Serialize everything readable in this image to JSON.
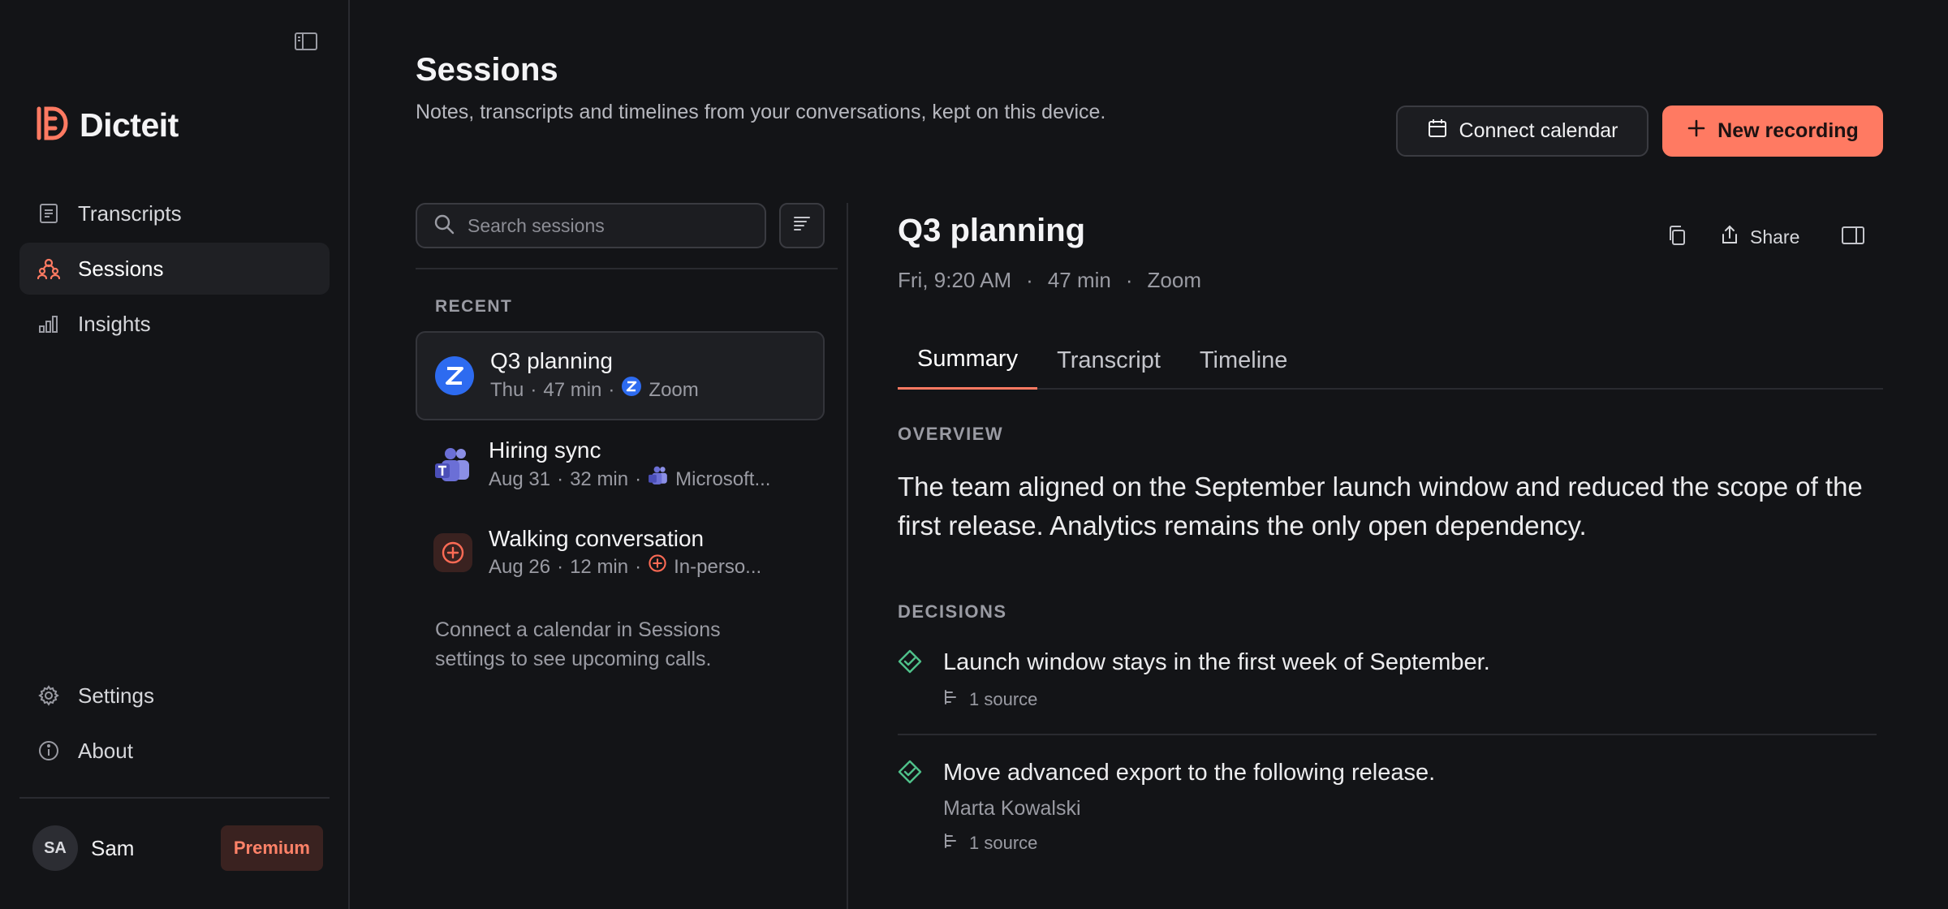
{
  "app": {
    "name": "Dicteit"
  },
  "sidebar": {
    "nav": [
      {
        "label": "Transcripts",
        "icon": "document-icon"
      },
      {
        "label": "Sessions",
        "icon": "people-icon",
        "active": true
      },
      {
        "label": "Insights",
        "icon": "bar-chart-icon"
      }
    ],
    "bottom": [
      {
        "label": "Settings",
        "icon": "gear-icon"
      },
      {
        "label": "About",
        "icon": "info-icon"
      }
    ],
    "user": {
      "initials": "SA",
      "name": "Sam",
      "plan": "Premium"
    }
  },
  "header": {
    "title": "Sessions",
    "subtitle": "Notes, transcripts and timelines from your conversations, kept on this device.",
    "connect_calendar": "Connect calendar",
    "new_recording": "New recording"
  },
  "list": {
    "search_placeholder": "Search sessions",
    "recent_label": "RECENT",
    "sessions": [
      {
        "title": "Q3 planning",
        "day": "Thu",
        "duration": "47 min",
        "source": "Zoom",
        "app": "zoom"
      },
      {
        "title": "Hiring sync",
        "day": "Aug 31",
        "duration": "32 min",
        "source": "Microsoft...",
        "app": "teams"
      },
      {
        "title": "Walking conversation",
        "day": "Aug 26",
        "duration": "12 min",
        "source": "In-perso...",
        "app": "in-person"
      }
    ],
    "calendar_hint": "Connect a calendar in Sessions settings to see upcoming calls."
  },
  "detail": {
    "title": "Q3 planning",
    "meta": {
      "when": "Fri, 9:20 AM",
      "duration": "47 min",
      "source": "Zoom",
      "sep": "·"
    },
    "share": "Share",
    "tabs": [
      "Summary",
      "Transcript",
      "Timeline"
    ],
    "overview_label": "OVERVIEW",
    "overview": "The team aligned on the September launch window and reduced the scope of the first release. Analytics remains the only open dependency.",
    "decisions_label": "DECISIONS",
    "decisions": [
      {
        "text": "Launch window stays in the first week of September.",
        "owner": "",
        "sources": "1 source"
      },
      {
        "text": "Move advanced export to the following release.",
        "owner": "Marta Kowalski",
        "sources": "1 source"
      }
    ]
  },
  "colors": {
    "accent": "#ff7a62",
    "background": "#131417",
    "success": "#4fc08a",
    "zoom": "#2d6bf0",
    "teams": "#6b6fd6"
  }
}
